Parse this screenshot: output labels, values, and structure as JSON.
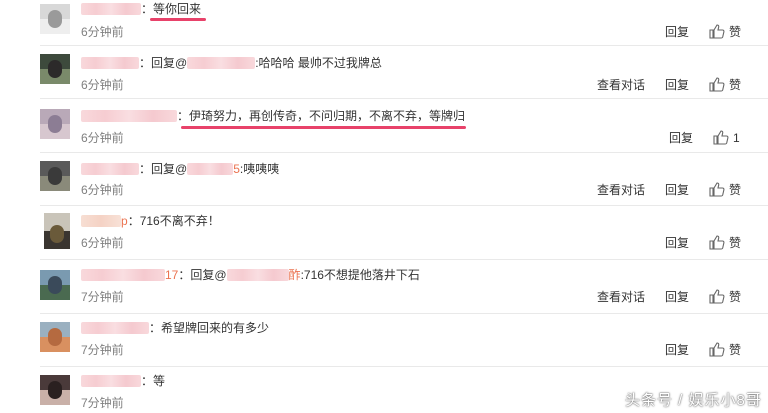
{
  "comments": [
    {
      "name": "",
      "reply_prefix": "",
      "reply_name": "",
      "text": "：等你回来",
      "time": "6分钟前",
      "actions": [
        "回复"
      ],
      "like_label": "赞"
    },
    {
      "name": "",
      "reply_prefix": "：回复@",
      "reply_name": "",
      "text": ":哈哈哈  最帅不过我牌总",
      "time": "6分钟前",
      "actions": [
        "查看对话",
        "回复"
      ],
      "like_label": "赞"
    },
    {
      "name": "",
      "reply_prefix": "",
      "reply_name": "",
      "text": "：伊琦努力，再创传奇，不问归期，不离不弃，等牌归",
      "time": "6分钟前",
      "actions": [
        "回复"
      ],
      "like_label": "1"
    },
    {
      "name": "",
      "reply_prefix": "：回复@",
      "reply_name": "5",
      "text": ":咦咦咦",
      "time": "6分钟前",
      "actions": [
        "查看对话",
        "回复"
      ],
      "like_label": "赞"
    },
    {
      "name": "p",
      "reply_prefix": "",
      "reply_name": "",
      "text": "：716不离不弃！",
      "time": "6分钟前",
      "actions": [
        "回复"
      ],
      "like_label": "赞"
    },
    {
      "name": "17",
      "reply_prefix": "：回复@",
      "reply_name": "酢",
      "text": ":716不想提他落井下石",
      "time": "7分钟前",
      "actions": [
        "查看对话",
        "回复"
      ],
      "like_label": "赞"
    },
    {
      "name": "",
      "reply_prefix": "",
      "reply_name": "",
      "text": "：希望牌回来的有多少",
      "time": "7分钟前",
      "actions": [
        "回复"
      ],
      "like_label": "赞"
    },
    {
      "name": "",
      "reply_prefix": "",
      "reply_name": "",
      "text": "：等",
      "time": "7分钟前",
      "actions": [],
      "like_label": ""
    }
  ],
  "watermark": "头条号 / 娱乐小8哥",
  "colors": {
    "link": "#eb7350",
    "underline": "#e8426a",
    "time": "#808080",
    "separator": "#e9e9e9"
  }
}
